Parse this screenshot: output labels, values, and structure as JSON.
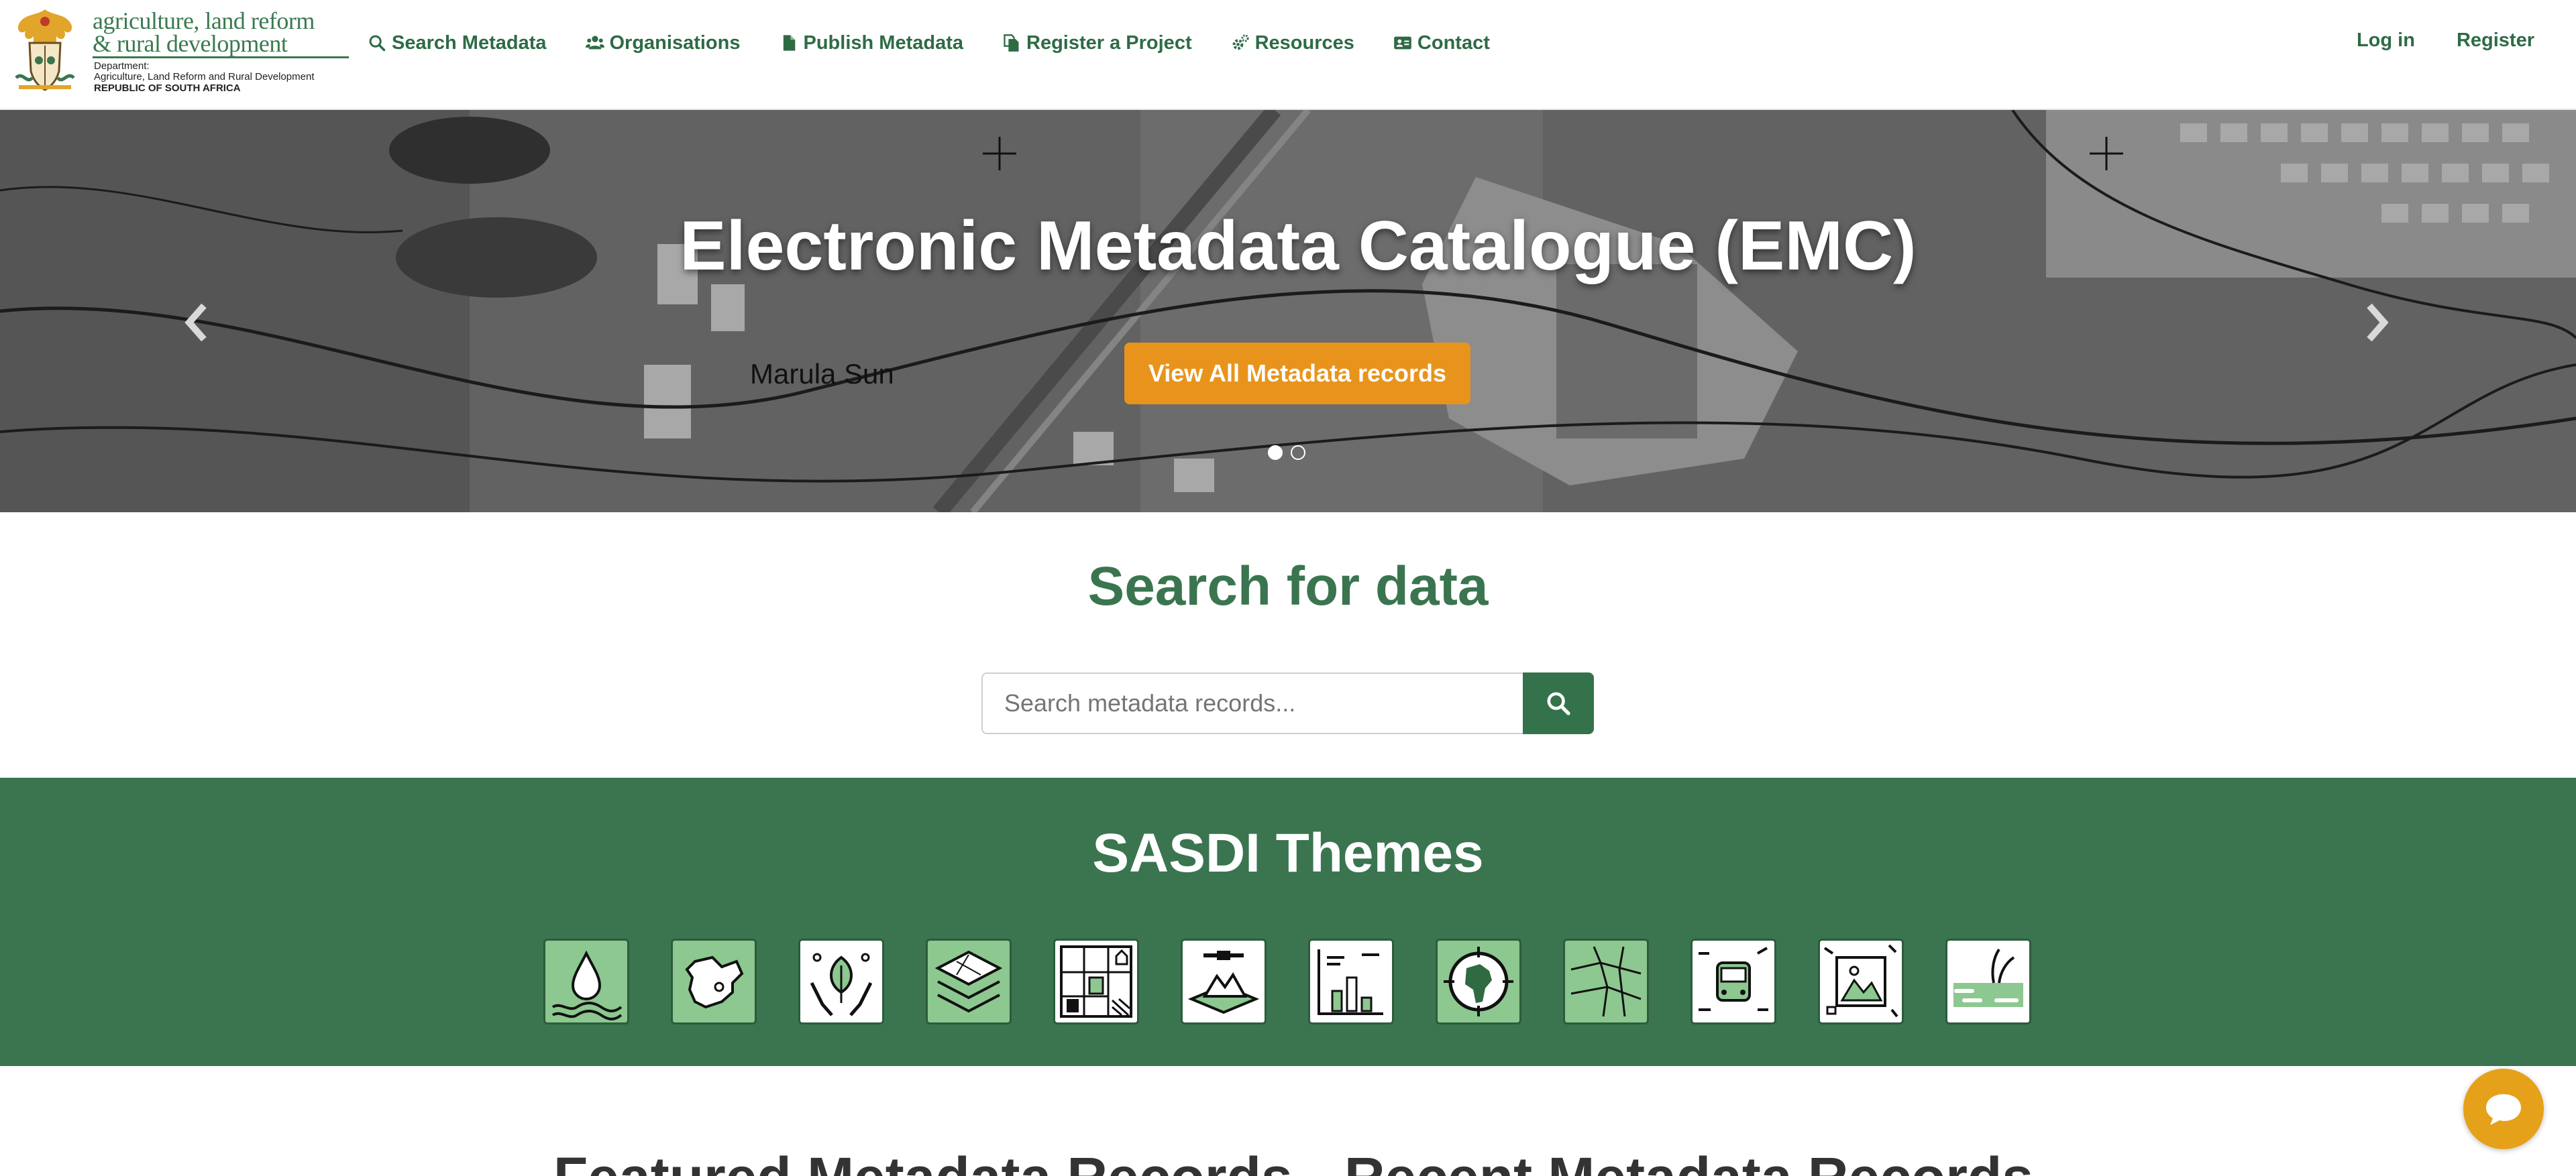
{
  "logo": {
    "line1": "agriculture, land reform",
    "line2": "& rural development",
    "dept_line1": "Department:",
    "dept_line2": "Agriculture, Land Reform and Rural Development",
    "country": "REPUBLIC OF SOUTH AFRICA"
  },
  "nav": {
    "items": [
      {
        "label": "Search Metadata",
        "icon": "search-icon"
      },
      {
        "label": "Organisations",
        "icon": "users-icon"
      },
      {
        "label": "Publish Metadata",
        "icon": "file-icon"
      },
      {
        "label": "Register a Project",
        "icon": "copy-icon"
      },
      {
        "label": "Resources",
        "icon": "cogs-icon"
      },
      {
        "label": "Contact",
        "icon": "address-card-icon"
      }
    ],
    "login": "Log in",
    "register": "Register"
  },
  "hero": {
    "title": "Electronic Metadata Catalogue (EMC)",
    "button": "View All Metadata records",
    "map_label": "Marula Sun",
    "slides": 2,
    "active_slide": 1
  },
  "search": {
    "title": "Search for data",
    "placeholder": "Search metadata records..."
  },
  "themes": {
    "title": "SASDI Themes",
    "items": [
      {
        "icon": "water-drop-icon",
        "style": "green"
      },
      {
        "icon": "south-africa-map-icon",
        "style": "green"
      },
      {
        "icon": "hands-leaf-icon",
        "style": "white"
      },
      {
        "icon": "land-layers-icon",
        "style": "green"
      },
      {
        "icon": "land-use-grid-icon",
        "style": "white"
      },
      {
        "icon": "satellite-terrain-icon",
        "style": "white"
      },
      {
        "icon": "statistics-chart-icon",
        "style": "white"
      },
      {
        "icon": "africa-globe-icon",
        "style": "green"
      },
      {
        "icon": "cadastral-parcels-icon",
        "style": "green"
      },
      {
        "icon": "transport-bus-icon",
        "style": "white"
      },
      {
        "icon": "imagery-frame-icon",
        "style": "white"
      },
      {
        "icon": "wetland-plant-icon",
        "style": "white"
      }
    ]
  },
  "bottom": {
    "featured": "Featured Metadata Records",
    "recent": "Recent Metadata Records"
  },
  "colors": {
    "brand_green": "#3a7550",
    "accent_orange": "#e8941c",
    "theme_tile_green": "#8cc88f"
  }
}
